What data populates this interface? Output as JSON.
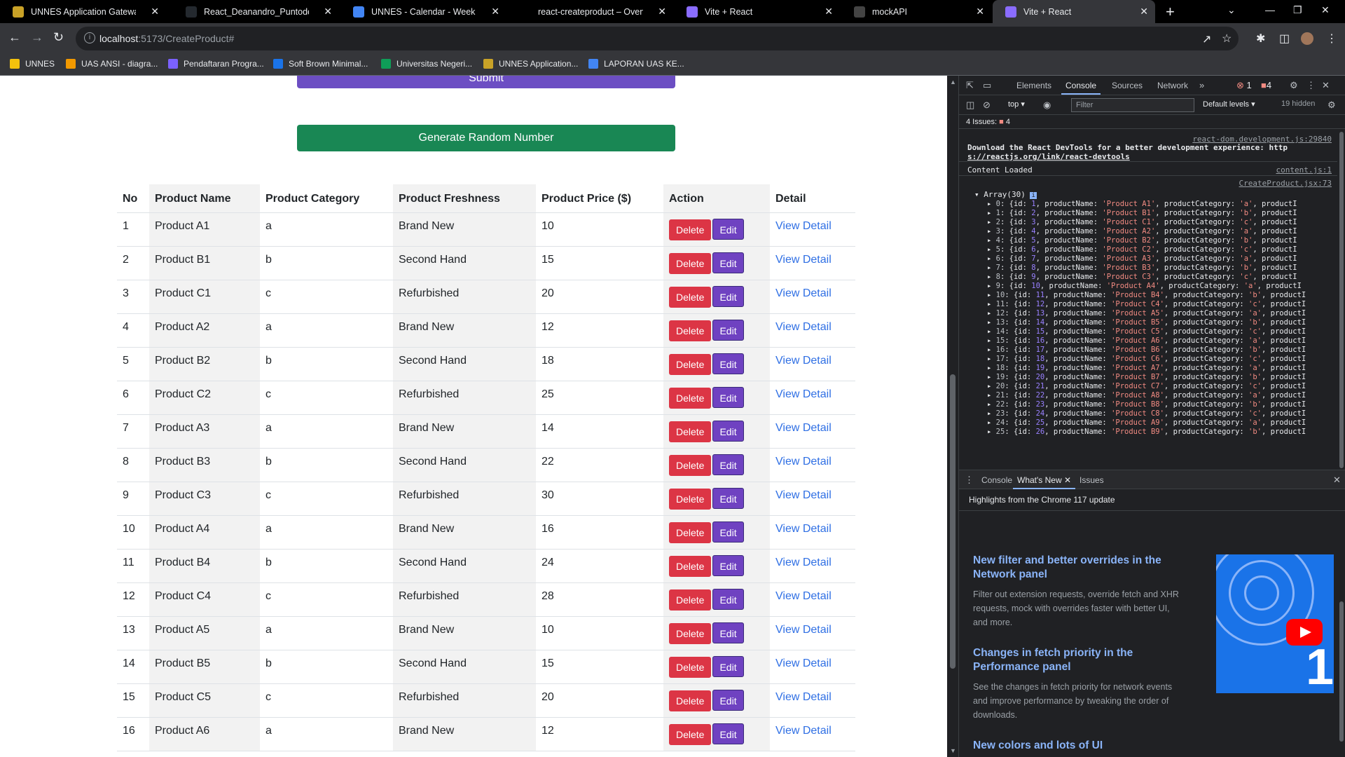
{
  "tabs": [
    {
      "title": "UNNES Application Gateway (B",
      "favicon_color": "#c9a227",
      "favicon": "unnes-logo-icon",
      "active": false
    },
    {
      "title": "React_Deanandro_Puntodewo/",
      "favicon_color": "#24292f",
      "favicon": "github-icon",
      "active": false
    },
    {
      "title": "UNNES - Calendar - Week of O",
      "favicon_color": "#4285f4",
      "favicon": "calendar-icon",
      "active": false
    },
    {
      "title": "react-createproduct – Overview",
      "favicon_color": "#000000",
      "favicon": "vercel-icon",
      "active": false
    },
    {
      "title": "Vite + React",
      "favicon_color": "#8a6cff",
      "favicon": "vite-icon",
      "active": false
    },
    {
      "title": "mockAPI",
      "favicon_color": "#444444",
      "favicon": "mockapi-icon",
      "active": false
    },
    {
      "title": "Vite + React",
      "favicon_color": "#8a6cff",
      "favicon": "vite-icon",
      "active": true
    }
  ],
  "address_bar": {
    "host": "localhost",
    "path": ":5173/CreateProduct#"
  },
  "bookmarks": [
    {
      "label": "UNNES",
      "color": "#f4c20d"
    },
    {
      "label": "UAS ANSI - diagra...",
      "color": "#f29900"
    },
    {
      "label": "Pendaftaran Progra...",
      "color": "#7b61ff"
    },
    {
      "label": "Soft Brown Minimal...",
      "color": "#1a73e8"
    },
    {
      "label": "Universitas Negeri...",
      "color": "#0f9d58"
    },
    {
      "label": "UNNES Application...",
      "color": "#c9a227"
    },
    {
      "label": "LAPORAN UAS KE...",
      "color": "#4285f4"
    }
  ],
  "page": {
    "submit_label": "Submit",
    "generate_label": "Generate Random Number",
    "columns": [
      "No",
      "Product Name",
      "Product Category",
      "Product Freshness",
      "Product Price ($)",
      "Action",
      "Detail"
    ],
    "delete_label": "Delete",
    "edit_label": "Edit",
    "detail_label": "View Detail",
    "rows": [
      {
        "no": "1",
        "name": "Product A1",
        "category": "a",
        "freshness": "Brand New",
        "price": "10"
      },
      {
        "no": "2",
        "name": "Product B1",
        "category": "b",
        "freshness": "Second Hand",
        "price": "15"
      },
      {
        "no": "3",
        "name": "Product C1",
        "category": "c",
        "freshness": "Refurbished",
        "price": "20"
      },
      {
        "no": "4",
        "name": "Product A2",
        "category": "a",
        "freshness": "Brand New",
        "price": "12"
      },
      {
        "no": "5",
        "name": "Product B2",
        "category": "b",
        "freshness": "Second Hand",
        "price": "18"
      },
      {
        "no": "6",
        "name": "Product C2",
        "category": "c",
        "freshness": "Refurbished",
        "price": "25"
      },
      {
        "no": "7",
        "name": "Product A3",
        "category": "a",
        "freshness": "Brand New",
        "price": "14"
      },
      {
        "no": "8",
        "name": "Product B3",
        "category": "b",
        "freshness": "Second Hand",
        "price": "22"
      },
      {
        "no": "9",
        "name": "Product C3",
        "category": "c",
        "freshness": "Refurbished",
        "price": "30"
      },
      {
        "no": "10",
        "name": "Product A4",
        "category": "a",
        "freshness": "Brand New",
        "price": "16"
      },
      {
        "no": "11",
        "name": "Product B4",
        "category": "b",
        "freshness": "Second Hand",
        "price": "24"
      },
      {
        "no": "12",
        "name": "Product C4",
        "category": "c",
        "freshness": "Refurbished",
        "price": "28"
      },
      {
        "no": "13",
        "name": "Product A5",
        "category": "a",
        "freshness": "Brand New",
        "price": "10"
      },
      {
        "no": "14",
        "name": "Product B5",
        "category": "b",
        "freshness": "Second Hand",
        "price": "15"
      },
      {
        "no": "15",
        "name": "Product C5",
        "category": "c",
        "freshness": "Refurbished",
        "price": "20"
      },
      {
        "no": "16",
        "name": "Product A6",
        "category": "a",
        "freshness": "Brand New",
        "price": "12"
      }
    ]
  },
  "devtools": {
    "tabs": [
      "Elements",
      "Console",
      "Sources",
      "Network"
    ],
    "active_tab": "Console",
    "error_count": "1",
    "issue_badge_count": "4",
    "context": "top",
    "filter_placeholder": "Filter",
    "levels": "Default levels",
    "hidden_count": "19 hidden",
    "issues_label": "4 Issues:",
    "issues_count": "4",
    "messages": {
      "src1": "react-dom.development.js:29840",
      "devtools_msg": "Download the React DevTools for a better development experience: http",
      "devtools_link": "s://reactjs.org/link/react-devtools",
      "content_loaded": "Content Loaded",
      "src2": "content.js:1",
      "src3": "CreateProduct.jsx:73",
      "array_label": "Array(30)"
    },
    "array_items": [
      {
        "idx": "0",
        "id": "1",
        "name": "'Product A1'",
        "cat": "'a'"
      },
      {
        "idx": "1",
        "id": "2",
        "name": "'Product B1'",
        "cat": "'b'"
      },
      {
        "idx": "2",
        "id": "3",
        "name": "'Product C1'",
        "cat": "'c'"
      },
      {
        "idx": "3",
        "id": "4",
        "name": "'Product A2'",
        "cat": "'a'"
      },
      {
        "idx": "4",
        "id": "5",
        "name": "'Product B2'",
        "cat": "'b'"
      },
      {
        "idx": "5",
        "id": "6",
        "name": "'Product C2'",
        "cat": "'c'"
      },
      {
        "idx": "6",
        "id": "7",
        "name": "'Product A3'",
        "cat": "'a'"
      },
      {
        "idx": "7",
        "id": "8",
        "name": "'Product B3'",
        "cat": "'b'"
      },
      {
        "idx": "8",
        "id": "9",
        "name": "'Product C3'",
        "cat": "'c'"
      },
      {
        "idx": "9",
        "id": "10",
        "name": "'Product A4'",
        "cat": "'a'"
      },
      {
        "idx": "10",
        "id": "11",
        "name": "'Product B4'",
        "cat": "'b'"
      },
      {
        "idx": "11",
        "id": "12",
        "name": "'Product C4'",
        "cat": "'c'"
      },
      {
        "idx": "12",
        "id": "13",
        "name": "'Product A5'",
        "cat": "'a'"
      },
      {
        "idx": "13",
        "id": "14",
        "name": "'Product B5'",
        "cat": "'b'"
      },
      {
        "idx": "14",
        "id": "15",
        "name": "'Product C5'",
        "cat": "'c'"
      },
      {
        "idx": "15",
        "id": "16",
        "name": "'Product A6'",
        "cat": "'a'"
      },
      {
        "idx": "16",
        "id": "17",
        "name": "'Product B6'",
        "cat": "'b'"
      },
      {
        "idx": "17",
        "id": "18",
        "name": "'Product C6'",
        "cat": "'c'"
      },
      {
        "idx": "18",
        "id": "19",
        "name": "'Product A7'",
        "cat": "'a'"
      },
      {
        "idx": "19",
        "id": "20",
        "name": "'Product B7'",
        "cat": "'b'"
      },
      {
        "idx": "20",
        "id": "21",
        "name": "'Product C7'",
        "cat": "'c'"
      },
      {
        "idx": "21",
        "id": "22",
        "name": "'Product A8'",
        "cat": "'a'"
      },
      {
        "idx": "22",
        "id": "23",
        "name": "'Product B8'",
        "cat": "'b'"
      },
      {
        "idx": "23",
        "id": "24",
        "name": "'Product C8'",
        "cat": "'c'"
      },
      {
        "idx": "24",
        "id": "25",
        "name": "'Product A9'",
        "cat": "'a'"
      },
      {
        "idx": "25",
        "id": "26",
        "name": "'Product B9'",
        "cat": "'b'"
      }
    ],
    "drawer_tabs": [
      "Console",
      "What's New",
      "Issues"
    ],
    "whats_new_header": "Highlights from the Chrome 117 update",
    "whats_new": [
      {
        "title": "New filter and better overrides in the Network panel",
        "body": "Filter out extension requests, override fetch and XHR requests, mock with overrides faster with better UI, and more."
      },
      {
        "title": "Changes in fetch priority in the Performance panel",
        "body": "See the changes in fetch priority for network events and improve performance by tweaking the order of downloads."
      },
      {
        "title": "New colors and lots of UI",
        "body": ""
      }
    ],
    "thumb_digit": "1"
  }
}
